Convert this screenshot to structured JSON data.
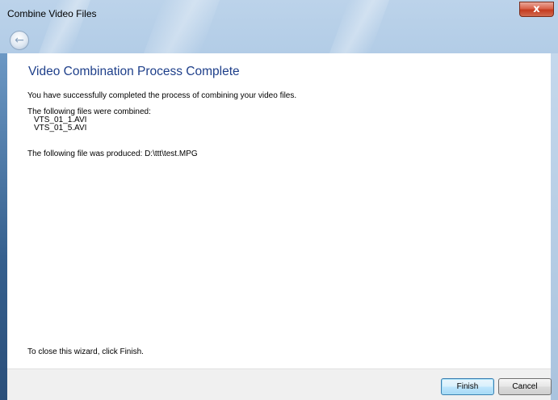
{
  "window": {
    "title": "Combine Video Files",
    "close_symbol": "x"
  },
  "nav": {
    "back_icon": "back-arrow-icon",
    "back_symbol": "←"
  },
  "main": {
    "heading": "Video Combination Process Complete",
    "success_message": "You have successfully completed the process of combining your video files.",
    "files_label": "The following files were combined:",
    "files": [
      "VTS_01_1.AVI",
      "VTS_01_5.AVI"
    ],
    "produced_message": "The following file was produced: D:\\ttt\\test.MPG",
    "close_instruction": "To close this wizard, click Finish."
  },
  "footer": {
    "finish_label": "Finish",
    "cancel_label": "Cancel"
  },
  "colors": {
    "heading": "#1e3f8a",
    "close_button": "#c43b1f",
    "footer_bg": "#f0f0f0"
  }
}
